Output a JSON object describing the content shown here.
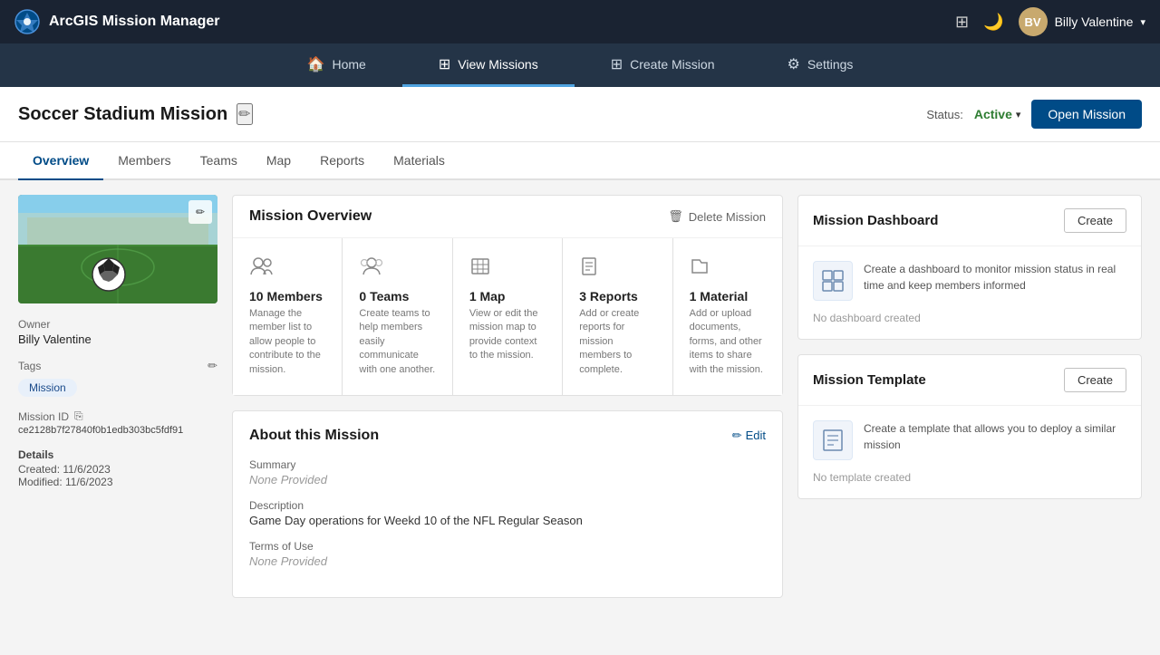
{
  "brand": {
    "app_name": "ArcGIS Mission Manager",
    "logo_alt": "ArcGIS Logo"
  },
  "nav": {
    "items": [
      {
        "id": "home",
        "label": "Home",
        "icon": "🏠",
        "active": false
      },
      {
        "id": "view-missions",
        "label": "View Missions",
        "icon": "⊞",
        "active": false
      },
      {
        "id": "create-mission",
        "label": "Create Mission",
        "icon": "⊞",
        "active": false
      },
      {
        "id": "settings",
        "label": "Settings",
        "icon": "⚙",
        "active": false
      }
    ]
  },
  "user": {
    "name": "Billy Valentine",
    "initials": "BV"
  },
  "mission": {
    "title": "Soccer Stadium Mission",
    "status": "Active",
    "open_button_label": "Open Mission"
  },
  "tabs": [
    {
      "id": "overview",
      "label": "Overview",
      "active": true
    },
    {
      "id": "members",
      "label": "Members",
      "active": false
    },
    {
      "id": "teams",
      "label": "Teams",
      "active": false
    },
    {
      "id": "map",
      "label": "Map",
      "active": false
    },
    {
      "id": "reports",
      "label": "Reports",
      "active": false
    },
    {
      "id": "materials",
      "label": "Materials",
      "active": false
    }
  ],
  "overview_section": {
    "title": "Mission Overview",
    "delete_label": "Delete Mission"
  },
  "stats": [
    {
      "id": "members",
      "icon": "👥",
      "title": "10 Members",
      "desc": "Manage the member list to allow people to contribute to the mission."
    },
    {
      "id": "teams",
      "icon": "👤",
      "title": "0 Teams",
      "desc": "Create teams to help members easily communicate with one another."
    },
    {
      "id": "map",
      "icon": "🗺",
      "title": "1 Map",
      "desc": "View or edit the mission map to provide context to the mission."
    },
    {
      "id": "reports",
      "icon": "📄",
      "title": "3 Reports",
      "desc": "Add or create reports for mission members to complete."
    },
    {
      "id": "material",
      "icon": "📁",
      "title": "1 Material",
      "desc": "Add or upload documents, forms, and other items to share with the mission."
    }
  ],
  "about": {
    "section_title": "About this Mission",
    "edit_label": "Edit",
    "fields": [
      {
        "label": "Summary",
        "value": "None Provided",
        "muted": true
      },
      {
        "label": "Description",
        "value": "Game Day operations for Weekd 10 of the NFL Regular Season",
        "muted": false
      },
      {
        "label": "Terms of Use",
        "value": "None Provided",
        "muted": true
      }
    ]
  },
  "sidebar": {
    "owner_label": "Owner",
    "owner_value": "Billy Valentine",
    "tags_label": "Tags",
    "tag_chip": "Mission",
    "mission_id_label": "Mission ID",
    "mission_id_value": "ce2128b7f27840f0b1edb303bc5fdf91",
    "details_label": "Details",
    "created": "Created: 11/6/2023",
    "modified": "Modified: 11/6/2023"
  },
  "mission_dashboard": {
    "title": "Mission Dashboard",
    "create_label": "Create",
    "desc": "Create a dashboard to monitor mission status in real time and keep members informed",
    "no_created": "No dashboard created"
  },
  "mission_template": {
    "title": "Mission Template",
    "create_label": "Create",
    "desc": "Create a template that allows you to deploy a similar mission",
    "no_created": "No template created"
  }
}
